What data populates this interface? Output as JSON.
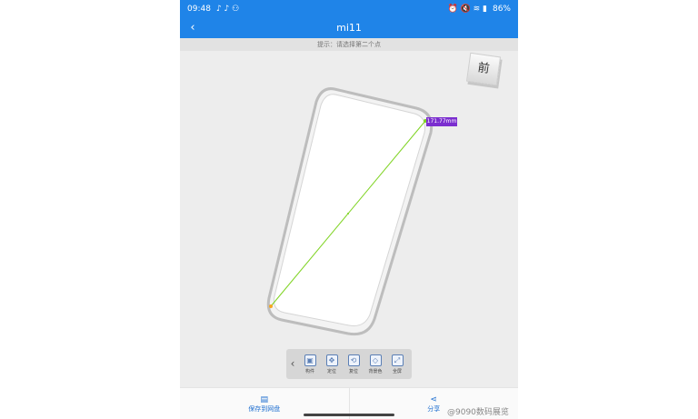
{
  "status_bar": {
    "time": "09:48",
    "left_icons": "♪ ♪ ⚇",
    "right_icons": "⏰ 🔇 ≋ ▮",
    "battery": "86%"
  },
  "header": {
    "back_glyph": "‹",
    "title": "mi11"
  },
  "hint": "提示：请选择第二个点",
  "view_cube_label": "前",
  "measurement": "171.77mm",
  "toolbar": {
    "back_glyph": "‹",
    "items": [
      {
        "label": "构件",
        "icon": "component-icon",
        "glyph": "▣"
      },
      {
        "label": "定位",
        "icon": "locate-icon",
        "glyph": "✥"
      },
      {
        "label": "复位",
        "icon": "reset-icon",
        "glyph": "⟲"
      },
      {
        "label": "背景色",
        "icon": "background-color-icon",
        "glyph": "◇"
      },
      {
        "label": "全屏",
        "icon": "fullscreen-icon",
        "glyph": "⤢"
      }
    ]
  },
  "bottom": {
    "save_icon": "▤",
    "save_label": "保存到网盘",
    "share_icon": "⋖",
    "share_label": "分享"
  },
  "watermark": "@9090数码展览",
  "colors": {
    "brand_blue": "#1f84e8",
    "measure_line": "#7ed321",
    "measure_label": "#7b2ecf"
  }
}
